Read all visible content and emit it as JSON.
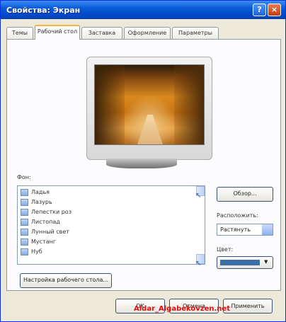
{
  "window": {
    "title": "Свойства: Экран",
    "help_label": "?",
    "close_label": "×"
  },
  "tabs": [
    {
      "label": "Темы"
    },
    {
      "label": "Рабочий стол"
    },
    {
      "label": "Заставка"
    },
    {
      "label": "Оформление"
    },
    {
      "label": "Параметры"
    }
  ],
  "desktop": {
    "group_label": "Фон:",
    "items": [
      {
        "label": "Ладья"
      },
      {
        "label": "Лазурь"
      },
      {
        "label": "Лепестки роз"
      },
      {
        "label": "Листопад"
      },
      {
        "label": "Лунный свет"
      },
      {
        "label": "Мустанг"
      },
      {
        "label": "Нуб"
      }
    ],
    "browse_label": "Обзор...",
    "position_label": "Расположить:",
    "position_value": "Растянуть",
    "color_label": "Цвет:",
    "color_value": "#3a6ea5",
    "customize_label": "Настройка рабочего стола..."
  },
  "footer": {
    "ok_label": "OK",
    "cancel_label": "Отмена",
    "apply_label": "Применить"
  },
  "watermark": "Aidar_Algabekovzen.net"
}
